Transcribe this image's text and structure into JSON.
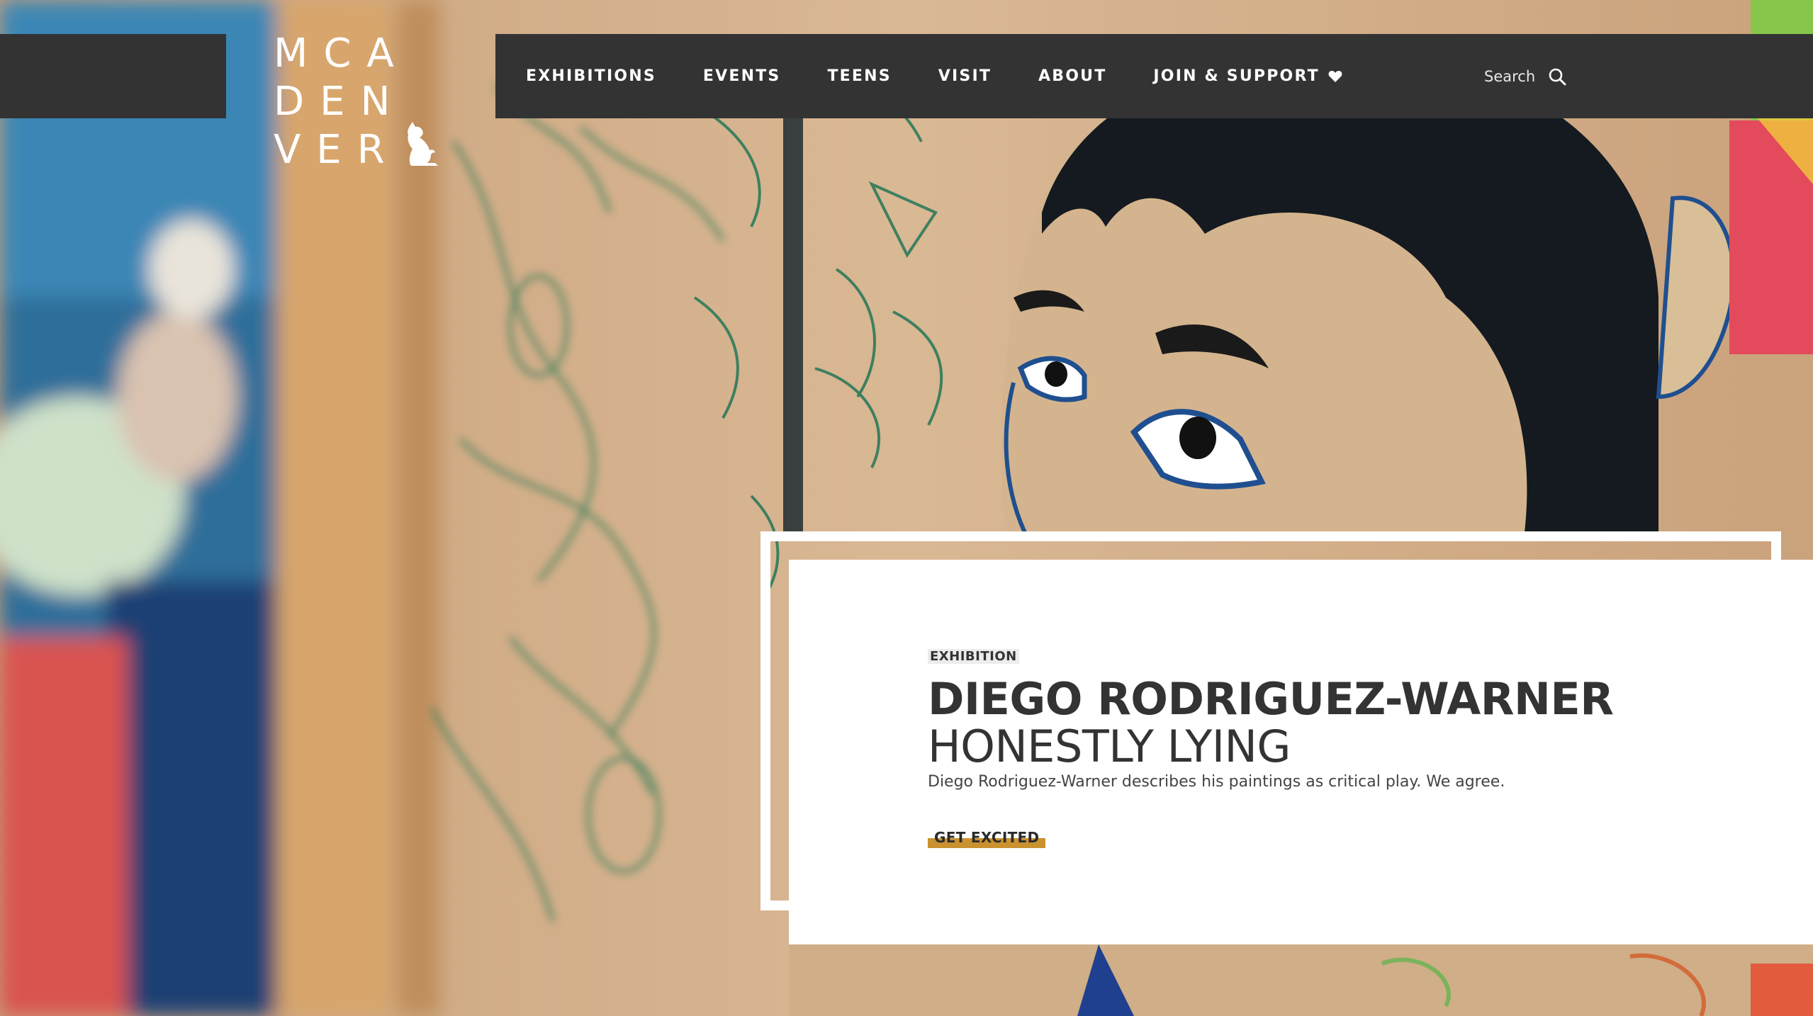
{
  "logo": {
    "rows": [
      "MCA",
      "DEN",
      "VER"
    ],
    "mascot_icon": "cat-icon"
  },
  "nav": {
    "items": [
      {
        "label": "EXHIBITIONS"
      },
      {
        "label": "EVENTS"
      },
      {
        "label": "TEENS"
      },
      {
        "label": "VISIT"
      },
      {
        "label": "ABOUT"
      },
      {
        "label": "JOIN & SUPPORT",
        "icon": "heart-icon"
      }
    ],
    "search_label": "Search",
    "search_icon": "search-icon"
  },
  "feature": {
    "eyebrow": "EXHIBITION",
    "title": "DIEGO RODRIGUEZ-WARNER",
    "subtitle": "HONESTLY LYING",
    "description": "Diego Rodriguez-Warner describes his paintings as critical play. We agree.",
    "cta_label": "GET EXCITED"
  },
  "colors": {
    "nav_background": "#333333",
    "accent": "#c9922f",
    "text_dark": "#333333"
  }
}
